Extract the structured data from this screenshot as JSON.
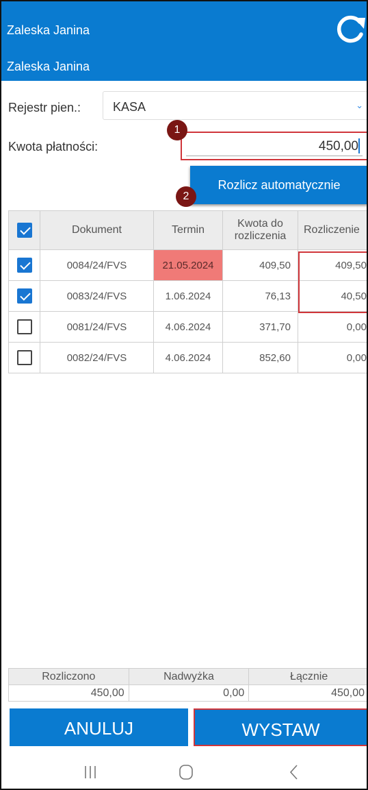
{
  "header": {
    "line1": "Zaleska Janina",
    "line2": "Zaleska Janina",
    "refresh_icon": "refresh-icon",
    "color": "#0a7bd0"
  },
  "form": {
    "register_label": "Rejestr pien.:",
    "register_value": "KASA",
    "amount_label": "Kwota płatności:",
    "amount_value": "450,00",
    "auto_button": "Rozlicz automatycznie"
  },
  "markers": {
    "first": "1",
    "second": "2"
  },
  "table": {
    "headers": {
      "document": "Dokument",
      "term": "Termin",
      "amount_line1": "Kwota do",
      "amount_line2": "rozliczenia",
      "settlement": "Rozliczenie"
    },
    "rows": [
      {
        "checked": true,
        "document": "0084/24/FVS",
        "term": "21.05.2024",
        "overdue": true,
        "amount": "409,50",
        "settlement": "409,50"
      },
      {
        "checked": true,
        "document": "0083/24/FVS",
        "term": "1.06.2024",
        "overdue": false,
        "amount": "76,13",
        "settlement": "40,50"
      },
      {
        "checked": false,
        "document": "0081/24/FVS",
        "term": "4.06.2024",
        "overdue": false,
        "amount": "371,70",
        "settlement": "0,00"
      },
      {
        "checked": false,
        "document": "0082/24/FVS",
        "term": "4.06.2024",
        "overdue": false,
        "amount": "852,60",
        "settlement": "0,00"
      }
    ],
    "overdue_color": "#f07a77"
  },
  "summary": {
    "settled_label": "Rozliczono",
    "surplus_label": "Nadwyżka",
    "total_label": "Łącznie",
    "settled_value": "450,00",
    "surplus_value": "0,00",
    "total_value": "450,00"
  },
  "actions": {
    "cancel": "ANULUJ",
    "issue": "WYSTAW"
  },
  "navbar": {
    "recents_icon": "recent-apps-icon",
    "home_icon": "home-icon",
    "back_icon": "back-icon"
  },
  "colors": {
    "accent": "#0a7bd0",
    "highlight": "#d0353a",
    "marker": "#7a1614"
  }
}
